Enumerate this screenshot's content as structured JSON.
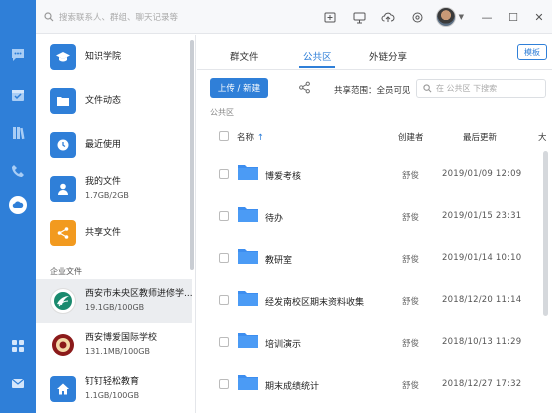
{
  "topbar": {
    "search_placeholder": "搜索联系人、群组、聊天记录等"
  },
  "sidebar": {
    "items": [
      {
        "title": "知识学院",
        "sub": "",
        "icon": "graduation-cap-icon",
        "color": "#2f7fd8"
      },
      {
        "title": "文件动态",
        "sub": "",
        "icon": "folder-activity-icon",
        "color": "#2f7fd8"
      },
      {
        "title": "最近使用",
        "sub": "",
        "icon": "clock-icon",
        "color": "#2f7fd8"
      },
      {
        "title": "我的文件",
        "sub": "1.7GB/2GB",
        "icon": "user-icon",
        "color": "#2f7fd8"
      },
      {
        "title": "共享文件",
        "sub": "",
        "icon": "share-icon",
        "color": "#f29a1f"
      }
    ],
    "section_label": "企业文件",
    "orgs": [
      {
        "title": "西安市未央区教师进修学...",
        "sub": "19.1GB/100GB",
        "icon": "school-logo-icon"
      },
      {
        "title": "西安博爱国际学校",
        "sub": "131.1MB/100GB",
        "icon": "school-seal-icon"
      },
      {
        "title": "钉钉轻松教育",
        "sub": "1.1GB/100GB",
        "icon": "home-icon"
      }
    ]
  },
  "main": {
    "tabs": [
      "群文件",
      "公共区",
      "外链分享"
    ],
    "template_button": "模板",
    "upload_button": "上传 / 新建",
    "scope": "共享范围：全员可见",
    "search_placeholder": "在 公共区 下搜索",
    "breadcrumb": "公共区",
    "columns": {
      "name": "名称",
      "creator": "创建者",
      "updated": "最后更新",
      "size": "大"
    },
    "rows": [
      {
        "name": "博爱考核",
        "creator": "舒俊",
        "date": "2019/01/09 12:09"
      },
      {
        "name": "待办",
        "creator": "舒俊",
        "date": "2019/01/15 23:31"
      },
      {
        "name": "教研室",
        "creator": "舒俊",
        "date": "2019/01/14 10:10"
      },
      {
        "name": "经发南校区期末资料收集",
        "creator": "舒俊",
        "date": "2018/12/20 11:14"
      },
      {
        "name": "培训演示",
        "creator": "舒俊",
        "date": "2018/10/13 11:29"
      },
      {
        "name": "期末成绩统计",
        "creator": "舒俊",
        "date": "2018/12/27 17:32"
      }
    ]
  },
  "colors": {
    "accent": "#2f7fd8",
    "rail": "#2f7fd8",
    "folder": "#3d8ef0",
    "share": "#f29a1f"
  }
}
